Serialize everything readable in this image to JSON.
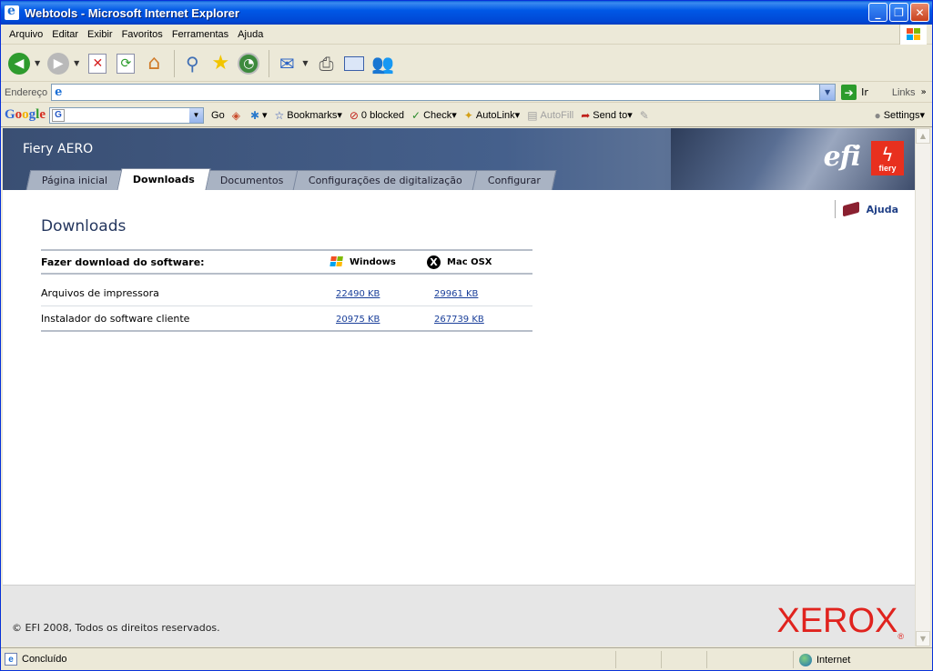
{
  "window": {
    "title": "Webtools - Microsoft Internet Explorer",
    "buttons": {
      "minimize": "_",
      "maximize": "❐",
      "close": "✕"
    }
  },
  "menubar": {
    "items": [
      "Arquivo",
      "Editar",
      "Exibir",
      "Favoritos",
      "Ferramentas",
      "Ajuda"
    ]
  },
  "toolbar": {
    "icons": [
      "back-icon",
      "forward-icon",
      "stop-icon",
      "refresh-icon",
      "home-icon",
      "search-icon",
      "favorites-icon",
      "history-icon",
      "mail-icon",
      "print-icon",
      "edit-icon",
      "messenger-icon"
    ]
  },
  "addressbar": {
    "label": "Endereço",
    "url": "",
    "go_label": "Ir",
    "links_label": "Links"
  },
  "googlebar": {
    "logo": "Google",
    "search_value": "",
    "go_label": "Go",
    "bookmarks_label": "Bookmarks",
    "blocked_label": "0 blocked",
    "check_label": "Check",
    "autolink_label": "AutoLink",
    "autofill_label": "AutoFill",
    "sendto_label": "Send to",
    "settings_label": "Settings"
  },
  "page": {
    "brand": "Fiery AERO",
    "efi_logo": "efi",
    "fiery_logo": "fiery",
    "tabs": [
      {
        "label": "Página inicial",
        "active": false
      },
      {
        "label": "Downloads",
        "active": true
      },
      {
        "label": "Documentos",
        "active": false
      },
      {
        "label": "Configurações de digitalização",
        "active": false
      },
      {
        "label": "Configurar",
        "active": false
      }
    ],
    "help_label": "Ajuda",
    "heading": "Downloads",
    "table": {
      "header": "Fazer download do software:",
      "col_windows": "Windows",
      "col_mac": "Mac OSX",
      "rows": [
        {
          "name": "Arquivos de impressora",
          "windows": "22490 KB",
          "mac": "29961 KB"
        },
        {
          "name": "Instalador do software cliente",
          "windows": "20975 KB",
          "mac": "267739 KB"
        }
      ]
    },
    "footer": {
      "copyright": "© EFI 2008, Todos os direitos reservados.",
      "xerox_logo": "XEROX"
    }
  },
  "statusbar": {
    "status": "Concluído",
    "zone": "Internet"
  },
  "colors": {
    "titlebar": "#0058e6",
    "banner": "#45608c",
    "heading": "#24365e",
    "link": "#1a3f9a",
    "xerox_red": "#e0231e",
    "fiery_red": "#e8301e"
  }
}
